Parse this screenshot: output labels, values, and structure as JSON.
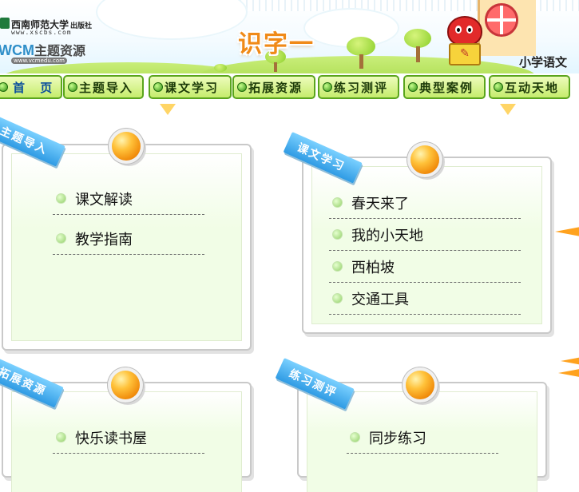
{
  "header": {
    "publisher_name": "西南师范大学",
    "publisher_suffix": "出版社",
    "publisher_url": "www.xscbs.com",
    "brand_latin": "WCM",
    "brand_cn": "主题资源",
    "brand_url": "www.vcmedu.com",
    "banner_title": "识字一",
    "subject": "小学语文"
  },
  "nav": {
    "items": [
      {
        "label": "首 页"
      },
      {
        "label": "主题导入"
      },
      {
        "label": "课文学习"
      },
      {
        "label": "拓展资源"
      },
      {
        "label": "练习测评"
      },
      {
        "label": "典型案例"
      },
      {
        "label": "互动天地"
      }
    ]
  },
  "boards": {
    "intro": {
      "ribbon": "主题导入",
      "items": [
        "课文解读",
        "教学指南"
      ]
    },
    "lessons": {
      "ribbon": "课文学习",
      "items": [
        "春天来了",
        "我的小天地",
        "西柏坡",
        "交通工具"
      ]
    },
    "extend": {
      "ribbon": "拓展资源",
      "items": [
        "快乐读书屋"
      ]
    },
    "practice": {
      "ribbon": "练习测评",
      "items": [
        "同步练习"
      ]
    }
  },
  "colors": {
    "nav_bg": "#c5ec6c",
    "nav_border": "#5aa51d",
    "ribbon_blue": "#2f9be4",
    "pin_orange": "#ffc23a",
    "title_orange": "#f08a18"
  },
  "icons": {
    "nav_bullet": "green-dot-icon",
    "item_bullet": "light-green-dot-icon",
    "pin": "orange-pin-icon",
    "mascot": "red-mascot-image"
  }
}
